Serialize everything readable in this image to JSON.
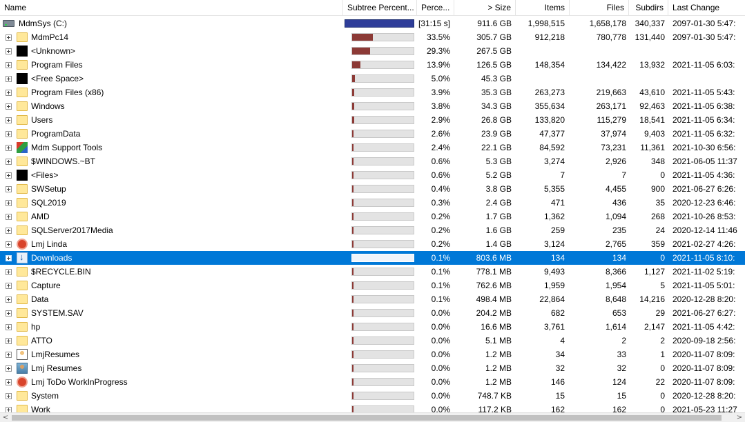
{
  "columns": [
    {
      "key": "name",
      "label": "Name"
    },
    {
      "key": "subtree",
      "label": "Subtree Percent..."
    },
    {
      "key": "perc",
      "label": "Perce..."
    },
    {
      "key": "size",
      "label": "> Size"
    },
    {
      "key": "items",
      "label": "Items"
    },
    {
      "key": "files",
      "label": "Files"
    },
    {
      "key": "subdirs",
      "label": "Subdirs"
    },
    {
      "key": "lastchange",
      "label": "Last Change"
    }
  ],
  "root": {
    "name": "MdmSys (C:)",
    "icon": "drive-icon",
    "bar": 1.0,
    "perc": "[31:15 s]",
    "size": "911.6 GB",
    "items": "1,998,515",
    "files": "1,658,178",
    "subdirs": "340,337",
    "lastchange": "2097-01-30  5:47:"
  },
  "rows": [
    {
      "name": "MdmPc14",
      "icon": "folder-icon",
      "bar": 0.335,
      "perc": "33.5%",
      "size": "305.7 GB",
      "items": "912,218",
      "files": "780,778",
      "subdirs": "131,440",
      "lastchange": "2097-01-30  5:47:"
    },
    {
      "name": "<Unknown>",
      "icon": "black-icon",
      "bar": 0.293,
      "perc": "29.3%",
      "size": "267.5 GB",
      "items": "",
      "files": "",
      "subdirs": "",
      "lastchange": ""
    },
    {
      "name": "Program Files",
      "icon": "folder-icon",
      "bar": 0.139,
      "perc": "13.9%",
      "size": "126.5 GB",
      "items": "148,354",
      "files": "134,422",
      "subdirs": "13,932",
      "lastchange": "2021-11-05  6:03:"
    },
    {
      "name": "<Free Space>",
      "icon": "black-icon",
      "bar": 0.05,
      "perc": "5.0%",
      "size": "45.3 GB",
      "items": "",
      "files": "",
      "subdirs": "",
      "lastchange": ""
    },
    {
      "name": "Program Files (x86)",
      "icon": "folder-icon",
      "bar": 0.039,
      "perc": "3.9%",
      "size": "35.3 GB",
      "items": "263,273",
      "files": "219,663",
      "subdirs": "43,610",
      "lastchange": "2021-11-05  5:43:"
    },
    {
      "name": "Windows",
      "icon": "folder-icon",
      "bar": 0.038,
      "perc": "3.8%",
      "size": "34.3 GB",
      "items": "355,634",
      "files": "263,171",
      "subdirs": "92,463",
      "lastchange": "2021-11-05  6:38:"
    },
    {
      "name": "Users",
      "icon": "folder-icon",
      "bar": 0.029,
      "perc": "2.9%",
      "size": "26.8 GB",
      "items": "133,820",
      "files": "115,279",
      "subdirs": "18,541",
      "lastchange": "2021-11-05  6:34:"
    },
    {
      "name": "ProgramData",
      "icon": "folder-icon",
      "bar": 0.026,
      "perc": "2.6%",
      "size": "23.9 GB",
      "items": "47,377",
      "files": "37,974",
      "subdirs": "9,403",
      "lastchange": "2021-11-05  6:32:"
    },
    {
      "name": "Mdm Support Tools",
      "icon": "tools-icon",
      "bar": 0.024,
      "perc": "2.4%",
      "size": "22.1 GB",
      "items": "84,592",
      "files": "73,231",
      "subdirs": "11,361",
      "lastchange": "2021-10-30  6:56:"
    },
    {
      "name": "$WINDOWS.~BT",
      "icon": "folder-icon",
      "bar": 0.006,
      "perc": "0.6%",
      "size": "5.3 GB",
      "items": "3,274",
      "files": "2,926",
      "subdirs": "348",
      "lastchange": "2021-06-05  11:37"
    },
    {
      "name": "<Files>",
      "icon": "black-icon",
      "bar": 0.006,
      "perc": "0.6%",
      "size": "5.2 GB",
      "items": "7",
      "files": "7",
      "subdirs": "0",
      "lastchange": "2021-11-05  4:36:"
    },
    {
      "name": "SWSetup",
      "icon": "folder-icon",
      "bar": 0.004,
      "perc": "0.4%",
      "size": "3.8 GB",
      "items": "5,355",
      "files": "4,455",
      "subdirs": "900",
      "lastchange": "2021-06-27  6:26:"
    },
    {
      "name": "SQL2019",
      "icon": "folder-icon",
      "bar": 0.003,
      "perc": "0.3%",
      "size": "2.4 GB",
      "items": "471",
      "files": "436",
      "subdirs": "35",
      "lastchange": "2020-12-23  6:46:"
    },
    {
      "name": "AMD",
      "icon": "folder-icon",
      "bar": 0.002,
      "perc": "0.2%",
      "size": "1.7 GB",
      "items": "1,362",
      "files": "1,094",
      "subdirs": "268",
      "lastchange": "2021-10-26  8:53:"
    },
    {
      "name": "SQLServer2017Media",
      "icon": "folder-icon",
      "bar": 0.002,
      "perc": "0.2%",
      "size": "1.6 GB",
      "items": "259",
      "files": "235",
      "subdirs": "24",
      "lastchange": "2020-12-14  11:46"
    },
    {
      "name": "Lmj Linda",
      "icon": "red-circle-icon",
      "bar": 0.002,
      "perc": "0.2%",
      "size": "1.4 GB",
      "items": "3,124",
      "files": "2,765",
      "subdirs": "359",
      "lastchange": "2021-02-27  4:26:"
    },
    {
      "name": "Downloads",
      "icon": "download-icon",
      "bar": 0.001,
      "perc": "0.1%",
      "size": "803.6 MB",
      "items": "134",
      "files": "134",
      "subdirs": "0",
      "lastchange": "2021-11-05  8:10:",
      "selected": true
    },
    {
      "name": "$RECYCLE.BIN",
      "icon": "folder-icon",
      "bar": 0.001,
      "perc": "0.1%",
      "size": "778.1 MB",
      "items": "9,493",
      "files": "8,366",
      "subdirs": "1,127",
      "lastchange": "2021-11-02  5:19:"
    },
    {
      "name": "Capture",
      "icon": "folder-icon",
      "bar": 0.001,
      "perc": "0.1%",
      "size": "762.6 MB",
      "items": "1,959",
      "files": "1,954",
      "subdirs": "5",
      "lastchange": "2021-11-05  5:01:"
    },
    {
      "name": "Data",
      "icon": "folder-icon",
      "bar": 0.001,
      "perc": "0.1%",
      "size": "498.4 MB",
      "items": "22,864",
      "files": "8,648",
      "subdirs": "14,216",
      "lastchange": "2020-12-28  8:20:"
    },
    {
      "name": "SYSTEM.SAV",
      "icon": "folder-icon",
      "bar": 0.0,
      "perc": "0.0%",
      "size": "204.2 MB",
      "items": "682",
      "files": "653",
      "subdirs": "29",
      "lastchange": "2021-06-27  6:27:"
    },
    {
      "name": "hp",
      "icon": "folder-icon",
      "bar": 0.0,
      "perc": "0.0%",
      "size": "16.6 MB",
      "items": "3,761",
      "files": "1,614",
      "subdirs": "2,147",
      "lastchange": "2021-11-05  4:42:"
    },
    {
      "name": "ATTO",
      "icon": "folder-icon",
      "bar": 0.0,
      "perc": "0.0%",
      "size": "5.1 MB",
      "items": "4",
      "files": "2",
      "subdirs": "2",
      "lastchange": "2020-09-18  2:56:"
    },
    {
      "name": "LmjResumes",
      "icon": "person-icon",
      "bar": 0.0,
      "perc": "0.0%",
      "size": "1.2 MB",
      "items": "34",
      "files": "33",
      "subdirs": "1",
      "lastchange": "2020-11-07  8:09:"
    },
    {
      "name": "Lmj Resumes",
      "icon": "person2-icon",
      "bar": 0.0,
      "perc": "0.0%",
      "size": "1.2 MB",
      "items": "32",
      "files": "32",
      "subdirs": "0",
      "lastchange": "2020-11-07  8:09:"
    },
    {
      "name": "Lmj ToDo WorkInProgress",
      "icon": "red-circle-icon",
      "bar": 0.0,
      "perc": "0.0%",
      "size": "1.2 MB",
      "items": "146",
      "files": "124",
      "subdirs": "22",
      "lastchange": "2020-11-07  8:09:"
    },
    {
      "name": "System",
      "icon": "folder-icon",
      "bar": 0.0,
      "perc": "0.0%",
      "size": "748.7 KB",
      "items": "15",
      "files": "15",
      "subdirs": "0",
      "lastchange": "2020-12-28  8:20:"
    },
    {
      "name": "Work",
      "icon": "folder-icon",
      "bar": 0.0,
      "perc": "0.0%",
      "size": "117.2 KB",
      "items": "162",
      "files": "162",
      "subdirs": "0",
      "lastchange": "2021-05-23  11:27"
    }
  ],
  "scrollbar": {
    "left_arrow": "<",
    "right_arrow": ">"
  }
}
